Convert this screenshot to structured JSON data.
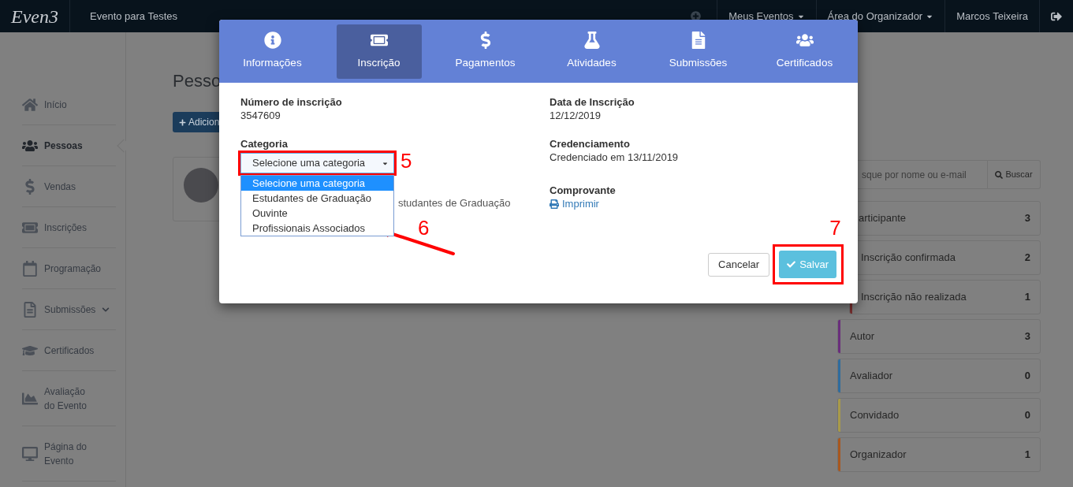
{
  "navbar": {
    "logo": "Even3",
    "event_name": "Evento para Testes",
    "menus": [
      {
        "label": "Meus Eventos"
      },
      {
        "label": "Área do Organizador"
      }
    ],
    "user": "Marcos Teixeira"
  },
  "sidebar": {
    "items": [
      {
        "label": "Início",
        "selected": false
      },
      {
        "label": "Pessoas",
        "selected": true
      },
      {
        "label": "Vendas",
        "selected": false
      },
      {
        "label": "Inscrições",
        "selected": false
      },
      {
        "label": "Programação",
        "selected": false
      },
      {
        "label": "Submissões",
        "selected": false,
        "expanded": false
      },
      {
        "label": "Certificados",
        "selected": false
      },
      {
        "label": "Avaliação do Evento",
        "selected": false
      },
      {
        "label": "Página do Evento",
        "selected": false
      }
    ]
  },
  "main": {
    "title": "Pesso",
    "add_button": "Adicion",
    "search": {
      "placeholder": "sque por nome ou e-mail",
      "button": "Buscar"
    },
    "filters": [
      {
        "label": "articipante",
        "count": "3",
        "children": [
          {
            "label": "Inscrição confirmada",
            "count": "2"
          },
          {
            "label": "Inscrição não realizada",
            "count": "1",
            "color": "#7a2f2f"
          }
        ]
      },
      {
        "label": "Autor",
        "count": "3",
        "color": "#6a2e7c"
      },
      {
        "label": "Avaliador",
        "count": "0",
        "color": "#2f6c9e"
      },
      {
        "label": "Convidado",
        "count": "0",
        "color": "#a89a4a"
      },
      {
        "label": "Organizador",
        "count": "1",
        "color": "#a8581f"
      }
    ]
  },
  "modal": {
    "tabs": [
      {
        "label": "Informações",
        "selected": false
      },
      {
        "label": "Inscrição",
        "selected": true
      },
      {
        "label": "Pagamentos",
        "selected": false
      },
      {
        "label": "Atividades",
        "selected": false
      },
      {
        "label": "Submissões",
        "selected": false
      },
      {
        "label": "Certificados",
        "selected": false
      }
    ],
    "registration_number": {
      "label": "Número de inscrição",
      "value": "3547609"
    },
    "category": {
      "label": "Categoria",
      "value": "Selecione uma categoria",
      "current": "studantes de Graduação",
      "expanded": true,
      "options": [
        {
          "label": "Selecione uma categoria",
          "selected": true
        },
        {
          "label": "Estudantes de Graduação",
          "selected": false
        },
        {
          "label": "Ouvinte",
          "selected": false
        },
        {
          "label": "Profissionais Associados",
          "selected": false
        }
      ]
    },
    "registration_date": {
      "label": "Data de Inscrição",
      "value": "12/12/2019"
    },
    "accreditation": {
      "label": "Credenciamento",
      "value": "Credenciado em 13/11/2019"
    },
    "receipt": {
      "label": "Comprovante",
      "link": "Imprimir"
    },
    "buttons": {
      "cancel": "Cancelar",
      "save": "Salvar"
    }
  },
  "annotations": [
    {
      "label": "5"
    },
    {
      "label": "6"
    },
    {
      "label": "7"
    }
  ]
}
